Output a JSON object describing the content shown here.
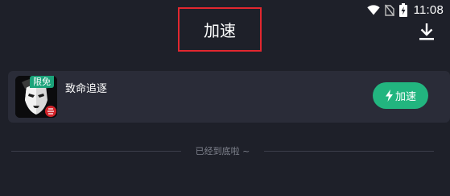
{
  "status_bar": {
    "time": "11:08",
    "icons": [
      "wifi-icon",
      "no-sim-icon",
      "battery-charging-icon"
    ]
  },
  "header": {
    "title": "加速",
    "download_icon": "download-icon"
  },
  "game_list": [
    {
      "name": "致命追逐",
      "badge": "限免",
      "icon": "game-icon",
      "button_label": "加速",
      "button_icon": "lightning-icon"
    }
  ],
  "footer": {
    "end_text": "已经到底啦 ~"
  },
  "colors": {
    "background": "#1e2029",
    "card": "#2a2c38",
    "accent": "#22b57f",
    "badge": "#1ba37a",
    "highlight_border": "#e2272f",
    "muted_text": "#7d808b"
  }
}
